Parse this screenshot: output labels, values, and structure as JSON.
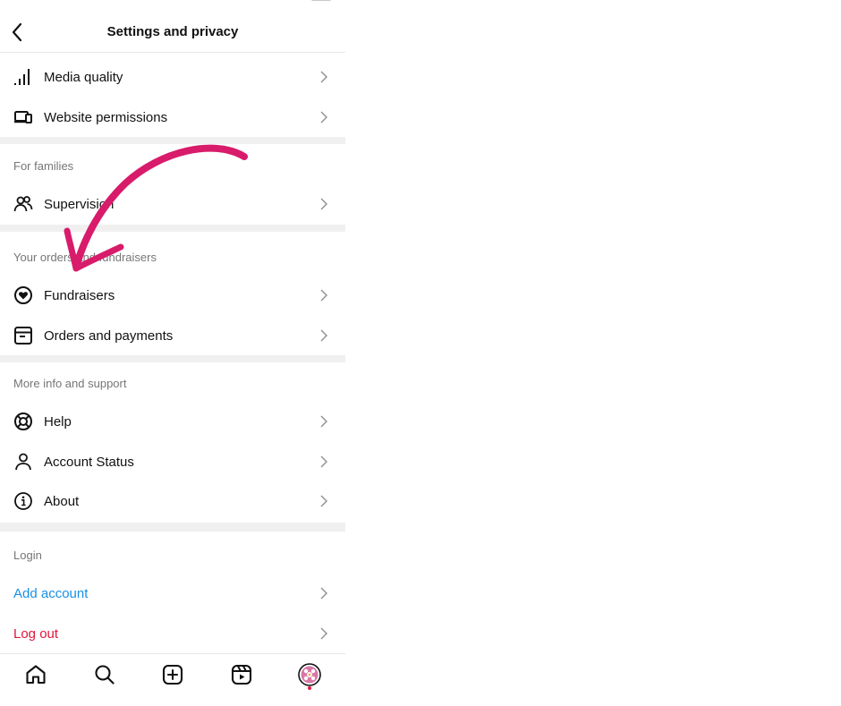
{
  "header": {
    "title": "Settings and privacy"
  },
  "rows": {
    "media_quality": "Media quality",
    "website_permissions": "Website permissions",
    "supervision": "Supervision",
    "fundraisers": "Fundraisers",
    "orders_payments": "Orders and payments",
    "help": "Help",
    "account_status": "Account Status",
    "about": "About",
    "add_account": "Add account",
    "log_out": "Log out"
  },
  "sections": {
    "for_families": "For families",
    "orders_fundraisers": "Your orders and fundraisers",
    "more_info": "More info and support",
    "login": "Login"
  },
  "colors": {
    "annotation_arrow": "#d81b6a",
    "link_blue": "#1a8fe3",
    "destructive_red": "#e0163c",
    "notification_dot": "#e0163c"
  },
  "icons": {
    "back": "chevron-left-icon",
    "media_quality": "signal-bars-icon",
    "website_permissions": "devices-icon",
    "supervision": "people-icon",
    "fundraisers": "heart-coin-icon",
    "orders_payments": "box-icon",
    "help": "lifebuoy-icon",
    "account_status": "person-icon",
    "about": "info-icon",
    "tab_home": "home-icon",
    "tab_search": "search-icon",
    "tab_create": "plus-square-icon",
    "tab_reels": "reels-icon",
    "tab_profile": "avatar"
  }
}
